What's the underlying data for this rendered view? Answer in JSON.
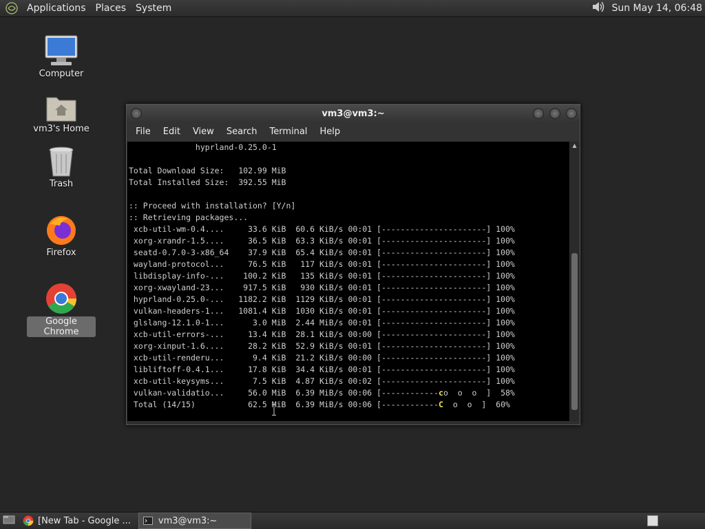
{
  "top_panel": {
    "menus": [
      "Applications",
      "Places",
      "System"
    ],
    "clock": "Sun May 14, 06:48",
    "icons": [
      "gnome-foot-icon",
      "volume-icon"
    ]
  },
  "desktop": {
    "icons": [
      {
        "label": "Computer",
        "icon": "computer-icon"
      },
      {
        "label": "vm3's Home",
        "icon": "home-folder-icon"
      },
      {
        "label": "Trash",
        "icon": "trash-icon"
      },
      {
        "label": "Firefox",
        "icon": "firefox-icon"
      },
      {
        "label": "Google Chrome",
        "icon": "chrome-icon",
        "selected": true
      }
    ]
  },
  "window": {
    "title": "vm3@vm3:~",
    "menu": [
      "File",
      "Edit",
      "View",
      "Search",
      "Terminal",
      "Help"
    ],
    "terminal_lines": [
      "              hyprland-0.25.0-1",
      "",
      "Total Download Size:   102.99 MiB",
      "Total Installed Size:  392.55 MiB",
      "",
      ":: Proceed with installation? [Y/n]",
      ":: Retrieving packages...",
      " xcb-util-wm-0.4....     33.6 KiB  60.6 KiB/s 00:01 [----------------------] 100%",
      " xorg-xrandr-1.5....     36.5 KiB  63.3 KiB/s 00:01 [----------------------] 100%",
      " seatd-0.7.0-3-x86_64    37.9 KiB  65.4 KiB/s 00:01 [----------------------] 100%",
      " wayland-protocol...     76.5 KiB   117 KiB/s 00:01 [----------------------] 100%",
      " libdisplay-info-...    100.2 KiB   135 KiB/s 00:01 [----------------------] 100%",
      " xorg-xwayland-23...    917.5 KiB   930 KiB/s 00:01 [----------------------] 100%",
      " hyprland-0.25.0-...   1182.2 KiB  1129 KiB/s 00:01 [----------------------] 100%",
      " vulkan-headers-1...   1081.4 KiB  1030 KiB/s 00:01 [----------------------] 100%",
      " glslang-12.1.0-1...      3.0 MiB  2.44 MiB/s 00:01 [----------------------] 100%",
      " xcb-util-errors-...     13.4 KiB  28.1 KiB/s 00:00 [----------------------] 100%",
      " xorg-xinput-1.6....     28.2 KiB  52.9 KiB/s 00:01 [----------------------] 100%",
      " xcb-util-renderu...      9.4 KiB  21.2 KiB/s 00:00 [----------------------] 100%",
      " libliftoff-0.4.1...     17.8 KiB  34.4 KiB/s 00:01 [----------------------] 100%",
      " xcb-util-keysyms...      7.5 KiB  4.87 KiB/s 00:02 [----------------------] 100%",
      " vulkan-validatio...     56.0 MiB  6.39 MiB/s 00:06 [------------co  o  o  ]  58%",
      " Total (14/15)           62.5 MiB  6.39 MiB/s 00:06 [------------C  o  o  ]  60%"
    ],
    "scrollbar_fraction_visible": 0.56
  },
  "bottom_panel": {
    "tasks": [
      {
        "label": "[New Tab - Google ...",
        "icon": "chrome-icon",
        "active": false
      },
      {
        "label": "vm3@vm3:~",
        "icon": "terminal-icon",
        "active": true
      }
    ]
  },
  "colors": {
    "desktop_bg": "#262626",
    "terminal_bg": "#000000",
    "terminal_fg": "#d0d0d0",
    "pacman_accent": "#f0e060"
  }
}
